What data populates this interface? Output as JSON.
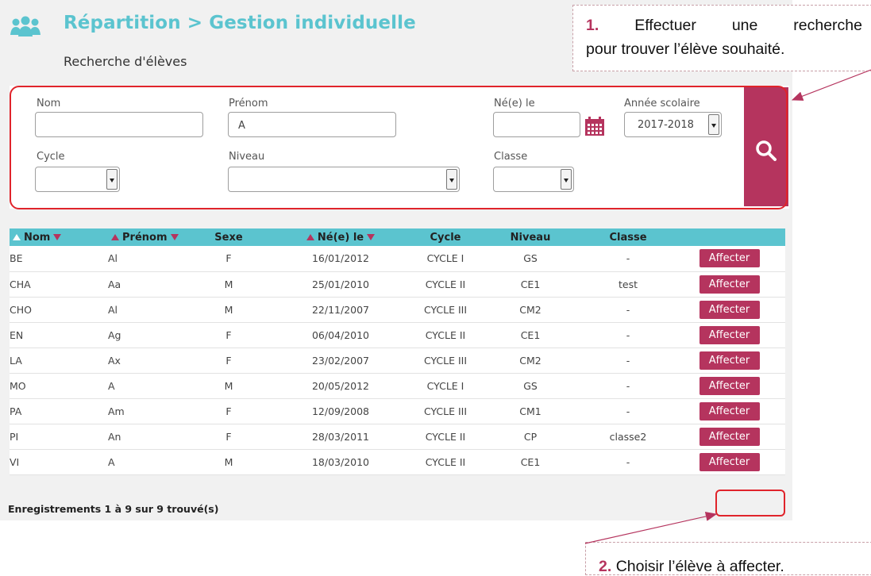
{
  "header": {
    "title": "Répartition > Gestion individuelle",
    "subtitle": "Recherche d'élèves"
  },
  "search": {
    "nom_label": "Nom",
    "nom_value": "",
    "prenom_label": "Prénom",
    "prenom_value": "A",
    "ne_le_label": "Né(e) le",
    "ne_le_value": "",
    "annee_label": "Année scolaire",
    "annee_value": "2017-2018",
    "cycle_label": "Cycle",
    "cycle_value": "",
    "niveau_label": "Niveau",
    "niveau_value": "",
    "classe_label": "Classe",
    "classe_value": ""
  },
  "table": {
    "columns": [
      "Nom",
      "Prénom",
      "Sexe",
      "Né(e) le",
      "Cycle",
      "Niveau",
      "Classe"
    ],
    "action_label": "Affecter",
    "rows": [
      {
        "nom": "BE",
        "prenom": "Al",
        "sexe": "F",
        "ne_le": "16/01/2012",
        "cycle": "CYCLE I",
        "niveau": "GS",
        "classe": "-"
      },
      {
        "nom": "CHA",
        "prenom": "Aa",
        "sexe": "M",
        "ne_le": "25/01/2010",
        "cycle": "CYCLE II",
        "niveau": "CE1",
        "classe": "test"
      },
      {
        "nom": "CHO",
        "prenom": "Al",
        "sexe": "M",
        "ne_le": "22/11/2007",
        "cycle": "CYCLE III",
        "niveau": "CM2",
        "classe": "-"
      },
      {
        "nom": "EN",
        "prenom": "Ag",
        "sexe": "F",
        "ne_le": "06/04/2010",
        "cycle": "CYCLE II",
        "niveau": "CE1",
        "classe": "-"
      },
      {
        "nom": "LA",
        "prenom": "Ax",
        "sexe": "F",
        "ne_le": "23/02/2007",
        "cycle": "CYCLE III",
        "niveau": "CM2",
        "classe": "-"
      },
      {
        "nom": "MO",
        "prenom": "A",
        "sexe": "M",
        "ne_le": "20/05/2012",
        "cycle": "CYCLE I",
        "niveau": "GS",
        "classe": "-"
      },
      {
        "nom": "PA",
        "prenom": "Am",
        "sexe": "F",
        "ne_le": "12/09/2008",
        "cycle": "CYCLE III",
        "niveau": "CM1",
        "classe": "-"
      },
      {
        "nom": "PI",
        "prenom": "An",
        "sexe": "F",
        "ne_le": "28/03/2011",
        "cycle": "CYCLE II",
        "niveau": "CP",
        "classe": "classe2"
      },
      {
        "nom": "VI",
        "prenom": "A",
        "sexe": "M",
        "ne_le": "18/03/2010",
        "cycle": "CYCLE II",
        "niveau": "CE1",
        "classe": "-"
      }
    ]
  },
  "records": "Enregistrements 1 à 9 sur 9 trouvé(s)",
  "callouts": {
    "step1_num": "1.",
    "step1_line1": "Effectuer une recherche",
    "step1_line2": "pour trouver l’élève souhaité.",
    "step2_num": "2.",
    "step2_text": "Choisir l’élève à affecter."
  },
  "colors": {
    "accent": "#5bc4cf",
    "button": "#b5345e",
    "highlight": "#e0242b"
  },
  "icons": {
    "header": "users-icon",
    "date": "calendar-icon",
    "search": "search-icon"
  }
}
